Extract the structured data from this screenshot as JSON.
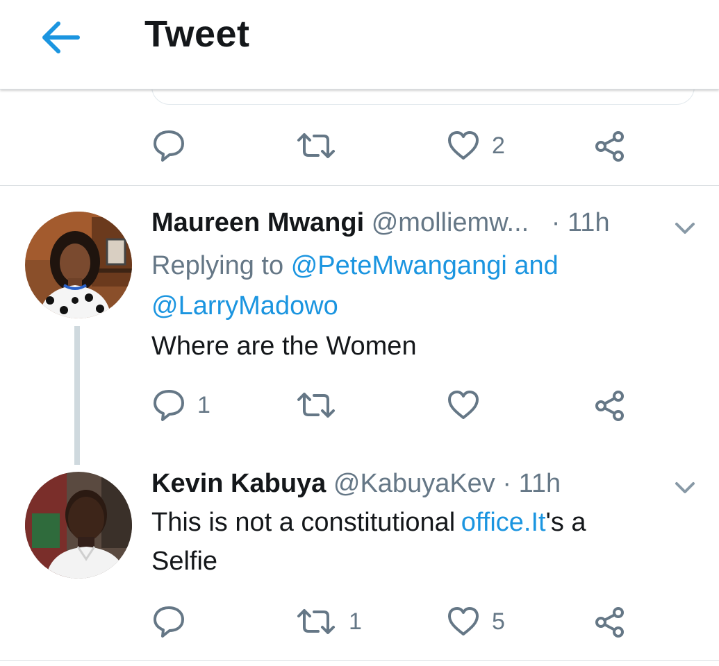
{
  "header": {
    "title": "Tweet",
    "accent": "#1b95e0"
  },
  "first_tweet_actions": {
    "reply_count": "",
    "retweet_count": "",
    "like_count": "2"
  },
  "tweets": [
    {
      "display_name": "Maureen Mwangi",
      "handle": "@molliemw...",
      "time": "· 11h",
      "replying_prefix": "Replying to",
      "replying_user1": "@PeteMwangangi",
      "replying_and": "and",
      "replying_user2": "@LarryMadowo",
      "text": "Where are the Women",
      "reply_count": "1",
      "retweet_count": "",
      "like_count": ""
    },
    {
      "display_name": "Kevin Kabuya",
      "handle": "@KabuyaKev",
      "time": "· 11h",
      "text_part1": "This is not a constitutional",
      "text_link": "office.It",
      "text_part2": "'s a",
      "text_line2": "Selfie",
      "reply_count": "",
      "retweet_count": "1",
      "like_count": "5"
    }
  ],
  "icons": {
    "back": "arrow-left-icon",
    "reply": "speech-bubble-icon",
    "retweet": "retweet-icon",
    "like": "heart-icon",
    "share": "share-icon",
    "more": "chevron-down-icon"
  }
}
